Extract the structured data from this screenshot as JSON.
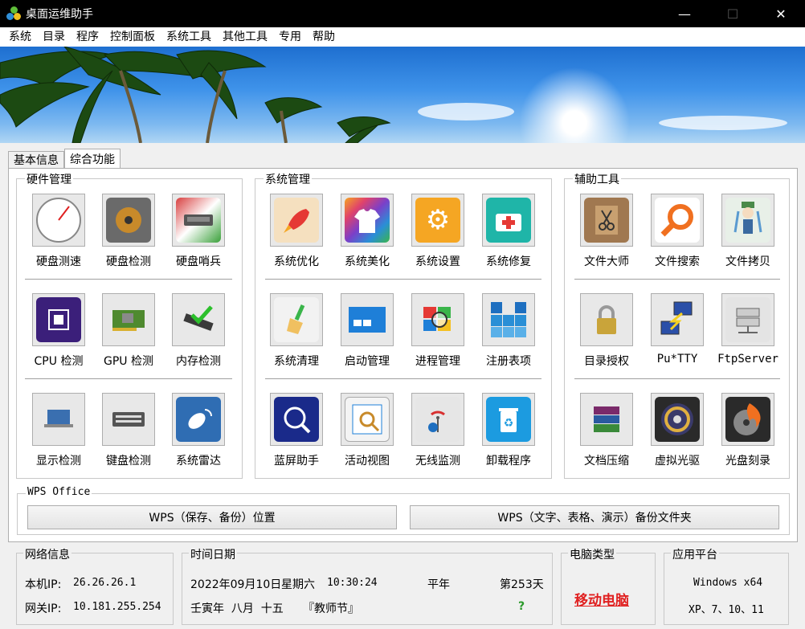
{
  "window": {
    "title": "桌面运维助手",
    "minimize": "—",
    "maximize": "☐",
    "close": "✕"
  },
  "menu": [
    "系统",
    "目录",
    "程序",
    "控制面板",
    "系统工具",
    "其他工具",
    "专用",
    "帮助"
  ],
  "tabs": [
    {
      "label": "基本信息",
      "active": false
    },
    {
      "label": "综合功能",
      "active": true
    }
  ],
  "groups": {
    "hardware": {
      "title": "硬件管理",
      "tools": [
        {
          "name": "disk-speed",
          "label": "硬盘测速",
          "icon": "gauge-icon",
          "color": "#ffffff",
          "glyph": ""
        },
        {
          "name": "disk-check",
          "label": "硬盘检测",
          "icon": "hard-disk-icon",
          "color": "#5a5a5a",
          "glyph": "◎"
        },
        {
          "name": "disk-sentinel",
          "label": "硬盘哨兵",
          "icon": "disk-sentinel-icon",
          "color": "#3a9a3a",
          "glyph": "▬"
        },
        {
          "name": "cpu-check",
          "label": "CPU 检测",
          "icon": "cpu-icon",
          "color": "#3b1f7a",
          "glyph": "▣"
        },
        {
          "name": "gpu-check",
          "label": "GPU 检测",
          "icon": "gpu-card-icon",
          "color": "#5e8f3a",
          "glyph": "▦"
        },
        {
          "name": "memory-check",
          "label": "内存检测",
          "icon": "memory-check-icon",
          "color": "#4a4a4a",
          "glyph": "✔"
        },
        {
          "name": "display-check",
          "label": "显示检测",
          "icon": "laptop-icon",
          "color": "#3a6fb0",
          "glyph": "▭"
        },
        {
          "name": "keyboard-check",
          "label": "键盘检测",
          "icon": "keyboard-icon",
          "color": "#6a6a6a",
          "glyph": "⌨"
        },
        {
          "name": "system-radar",
          "label": "系统雷达",
          "icon": "satellite-dish-icon",
          "color": "#2f6db3",
          "glyph": "📡"
        }
      ]
    },
    "system": {
      "title": "系统管理",
      "tools": [
        {
          "name": "system-optimize",
          "label": "系统优化",
          "icon": "rocket-icon",
          "color": "#f2d8b0",
          "glyph": "🚀"
        },
        {
          "name": "system-beautify",
          "label": "系统美化",
          "icon": "tshirt-icon",
          "color": "#e0436b",
          "glyph": "👕"
        },
        {
          "name": "system-settings",
          "label": "系统设置",
          "icon": "gear-icon",
          "color": "#f5a623",
          "glyph": "⚙"
        },
        {
          "name": "system-repair",
          "label": "系统修复",
          "icon": "first-aid-kit-icon",
          "color": "#1fb5a8",
          "glyph": "✚"
        },
        {
          "name": "system-clean",
          "label": "系统清理",
          "icon": "broom-icon",
          "color": "#f2f2f2",
          "glyph": "🧹"
        },
        {
          "name": "startup-manage",
          "label": "启动管理",
          "icon": "startup-window-icon",
          "color": "#1e7fd8",
          "glyph": "▭"
        },
        {
          "name": "process-manage",
          "label": "进程管理",
          "icon": "windows-magnifier-icon",
          "color": "#e8b830",
          "glyph": "🔍"
        },
        {
          "name": "registry-items",
          "label": "注册表项",
          "icon": "registry-blocks-icon",
          "color": "#2a8fd6",
          "glyph": "▦"
        },
        {
          "name": "bluescreen-helper",
          "label": "蓝屏助手",
          "icon": "bluescreen-search-icon",
          "color": "#1a2a8a",
          "glyph": "🔍"
        },
        {
          "name": "activity-view",
          "label": "活动视图",
          "icon": "activity-view-icon",
          "color": "#f4f4f4",
          "glyph": "🔎"
        },
        {
          "name": "wireless-monitor",
          "label": "无线监测",
          "icon": "wireless-info-icon",
          "color": "#e6e6e6",
          "glyph": "ℹ"
        },
        {
          "name": "uninstall",
          "label": "卸载程序",
          "icon": "recycle-bin-icon",
          "color": "#1c9be0",
          "glyph": "♻"
        }
      ]
    },
    "aux": {
      "title": "辅助工具",
      "tools": [
        {
          "name": "file-master",
          "label": "文件大师",
          "icon": "scissors-folder-icon",
          "color": "#a07850",
          "glyph": "✂"
        },
        {
          "name": "file-search",
          "label": "文件搜索",
          "icon": "magnifier-icon",
          "color": "#ffffff",
          "glyph": "🔍"
        },
        {
          "name": "file-copy",
          "label": "文件拷贝",
          "icon": "anime-character-icon",
          "color": "#e8f0e8",
          "glyph": "☺"
        },
        {
          "name": "dir-permission",
          "label": "目录授权",
          "icon": "padlock-icon",
          "color": "#c9a43a",
          "glyph": "🔒"
        },
        {
          "name": "putty",
          "label": "Pu*TTY",
          "icon": "putty-icon",
          "color": "#2a4fa8",
          "glyph": "⚡"
        },
        {
          "name": "ftp-server",
          "label": "FtpServer",
          "icon": "server-icon",
          "color": "#e4e4e4",
          "glyph": "🖧"
        },
        {
          "name": "archive",
          "label": "文档压缩",
          "icon": "winrar-books-icon",
          "color": "#7a2a6a",
          "glyph": "📚"
        },
        {
          "name": "virtual-drive",
          "label": "虚拟光驱",
          "icon": "optical-disc-icon",
          "color": "#2a2a2a",
          "glyph": "◉"
        },
        {
          "name": "disc-burn",
          "label": "光盘刻录",
          "icon": "burning-disc-icon",
          "color": "#2a2a2a",
          "glyph": "🔥"
        }
      ]
    }
  },
  "wps": {
    "title": "WPS Office",
    "location_button": "WPS（保存、备份）位置",
    "backup_button": "WPS（文字、表格、演示）备份文件夹"
  },
  "status": {
    "network": {
      "title": "网络信息",
      "local_ip_label": "本机IP:",
      "local_ip": "26.26.26.1",
      "gateway_label": "网关IP:",
      "gateway": "10.181.255.254"
    },
    "datetime": {
      "title": "时间日期",
      "date": "2022年09月10日",
      "weekday": "星期六",
      "time": "10:30:24",
      "year_type": "平年",
      "day_of_year": "第253天",
      "lunar": "壬寅年  八月  十五",
      "festival": "『教师节』",
      "unknown": "?"
    },
    "pc_type": {
      "title": "电脑类型",
      "value": "移动电脑"
    },
    "platform": {
      "title": "应用平台",
      "line1": "Windows x64",
      "line2": "XP、7、10、11"
    }
  }
}
